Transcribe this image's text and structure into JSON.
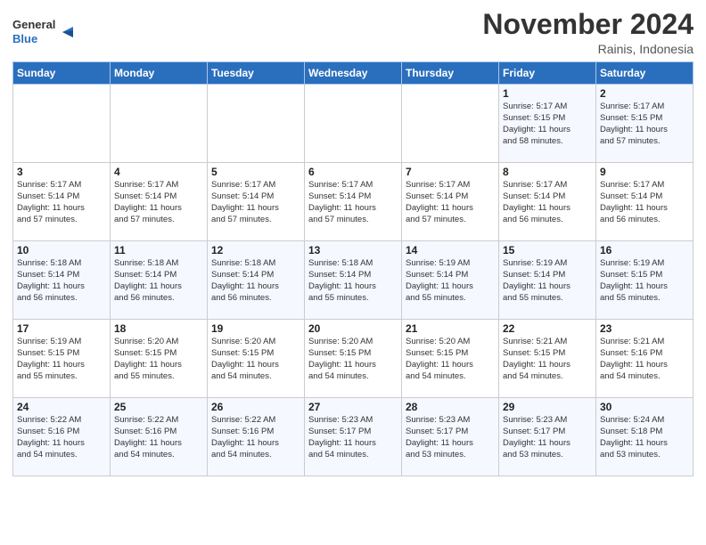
{
  "logo": {
    "line1": "General",
    "line2": "Blue"
  },
  "header": {
    "month": "November 2024",
    "location": "Rainis, Indonesia"
  },
  "weekdays": [
    "Sunday",
    "Monday",
    "Tuesday",
    "Wednesday",
    "Thursday",
    "Friday",
    "Saturday"
  ],
  "weeks": [
    [
      {
        "day": "",
        "info": ""
      },
      {
        "day": "",
        "info": ""
      },
      {
        "day": "",
        "info": ""
      },
      {
        "day": "",
        "info": ""
      },
      {
        "day": "",
        "info": ""
      },
      {
        "day": "1",
        "info": "Sunrise: 5:17 AM\nSunset: 5:15 PM\nDaylight: 11 hours\nand 58 minutes."
      },
      {
        "day": "2",
        "info": "Sunrise: 5:17 AM\nSunset: 5:15 PM\nDaylight: 11 hours\nand 57 minutes."
      }
    ],
    [
      {
        "day": "3",
        "info": "Sunrise: 5:17 AM\nSunset: 5:14 PM\nDaylight: 11 hours\nand 57 minutes."
      },
      {
        "day": "4",
        "info": "Sunrise: 5:17 AM\nSunset: 5:14 PM\nDaylight: 11 hours\nand 57 minutes."
      },
      {
        "day": "5",
        "info": "Sunrise: 5:17 AM\nSunset: 5:14 PM\nDaylight: 11 hours\nand 57 minutes."
      },
      {
        "day": "6",
        "info": "Sunrise: 5:17 AM\nSunset: 5:14 PM\nDaylight: 11 hours\nand 57 minutes."
      },
      {
        "day": "7",
        "info": "Sunrise: 5:17 AM\nSunset: 5:14 PM\nDaylight: 11 hours\nand 57 minutes."
      },
      {
        "day": "8",
        "info": "Sunrise: 5:17 AM\nSunset: 5:14 PM\nDaylight: 11 hours\nand 56 minutes."
      },
      {
        "day": "9",
        "info": "Sunrise: 5:17 AM\nSunset: 5:14 PM\nDaylight: 11 hours\nand 56 minutes."
      }
    ],
    [
      {
        "day": "10",
        "info": "Sunrise: 5:18 AM\nSunset: 5:14 PM\nDaylight: 11 hours\nand 56 minutes."
      },
      {
        "day": "11",
        "info": "Sunrise: 5:18 AM\nSunset: 5:14 PM\nDaylight: 11 hours\nand 56 minutes."
      },
      {
        "day": "12",
        "info": "Sunrise: 5:18 AM\nSunset: 5:14 PM\nDaylight: 11 hours\nand 56 minutes."
      },
      {
        "day": "13",
        "info": "Sunrise: 5:18 AM\nSunset: 5:14 PM\nDaylight: 11 hours\nand 55 minutes."
      },
      {
        "day": "14",
        "info": "Sunrise: 5:19 AM\nSunset: 5:14 PM\nDaylight: 11 hours\nand 55 minutes."
      },
      {
        "day": "15",
        "info": "Sunrise: 5:19 AM\nSunset: 5:14 PM\nDaylight: 11 hours\nand 55 minutes."
      },
      {
        "day": "16",
        "info": "Sunrise: 5:19 AM\nSunset: 5:15 PM\nDaylight: 11 hours\nand 55 minutes."
      }
    ],
    [
      {
        "day": "17",
        "info": "Sunrise: 5:19 AM\nSunset: 5:15 PM\nDaylight: 11 hours\nand 55 minutes."
      },
      {
        "day": "18",
        "info": "Sunrise: 5:20 AM\nSunset: 5:15 PM\nDaylight: 11 hours\nand 55 minutes."
      },
      {
        "day": "19",
        "info": "Sunrise: 5:20 AM\nSunset: 5:15 PM\nDaylight: 11 hours\nand 54 minutes."
      },
      {
        "day": "20",
        "info": "Sunrise: 5:20 AM\nSunset: 5:15 PM\nDaylight: 11 hours\nand 54 minutes."
      },
      {
        "day": "21",
        "info": "Sunrise: 5:20 AM\nSunset: 5:15 PM\nDaylight: 11 hours\nand 54 minutes."
      },
      {
        "day": "22",
        "info": "Sunrise: 5:21 AM\nSunset: 5:15 PM\nDaylight: 11 hours\nand 54 minutes."
      },
      {
        "day": "23",
        "info": "Sunrise: 5:21 AM\nSunset: 5:16 PM\nDaylight: 11 hours\nand 54 minutes."
      }
    ],
    [
      {
        "day": "24",
        "info": "Sunrise: 5:22 AM\nSunset: 5:16 PM\nDaylight: 11 hours\nand 54 minutes."
      },
      {
        "day": "25",
        "info": "Sunrise: 5:22 AM\nSunset: 5:16 PM\nDaylight: 11 hours\nand 54 minutes."
      },
      {
        "day": "26",
        "info": "Sunrise: 5:22 AM\nSunset: 5:16 PM\nDaylight: 11 hours\nand 54 minutes."
      },
      {
        "day": "27",
        "info": "Sunrise: 5:23 AM\nSunset: 5:17 PM\nDaylight: 11 hours\nand 54 minutes."
      },
      {
        "day": "28",
        "info": "Sunrise: 5:23 AM\nSunset: 5:17 PM\nDaylight: 11 hours\nand 53 minutes."
      },
      {
        "day": "29",
        "info": "Sunrise: 5:23 AM\nSunset: 5:17 PM\nDaylight: 11 hours\nand 53 minutes."
      },
      {
        "day": "30",
        "info": "Sunrise: 5:24 AM\nSunset: 5:18 PM\nDaylight: 11 hours\nand 53 minutes."
      }
    ]
  ]
}
